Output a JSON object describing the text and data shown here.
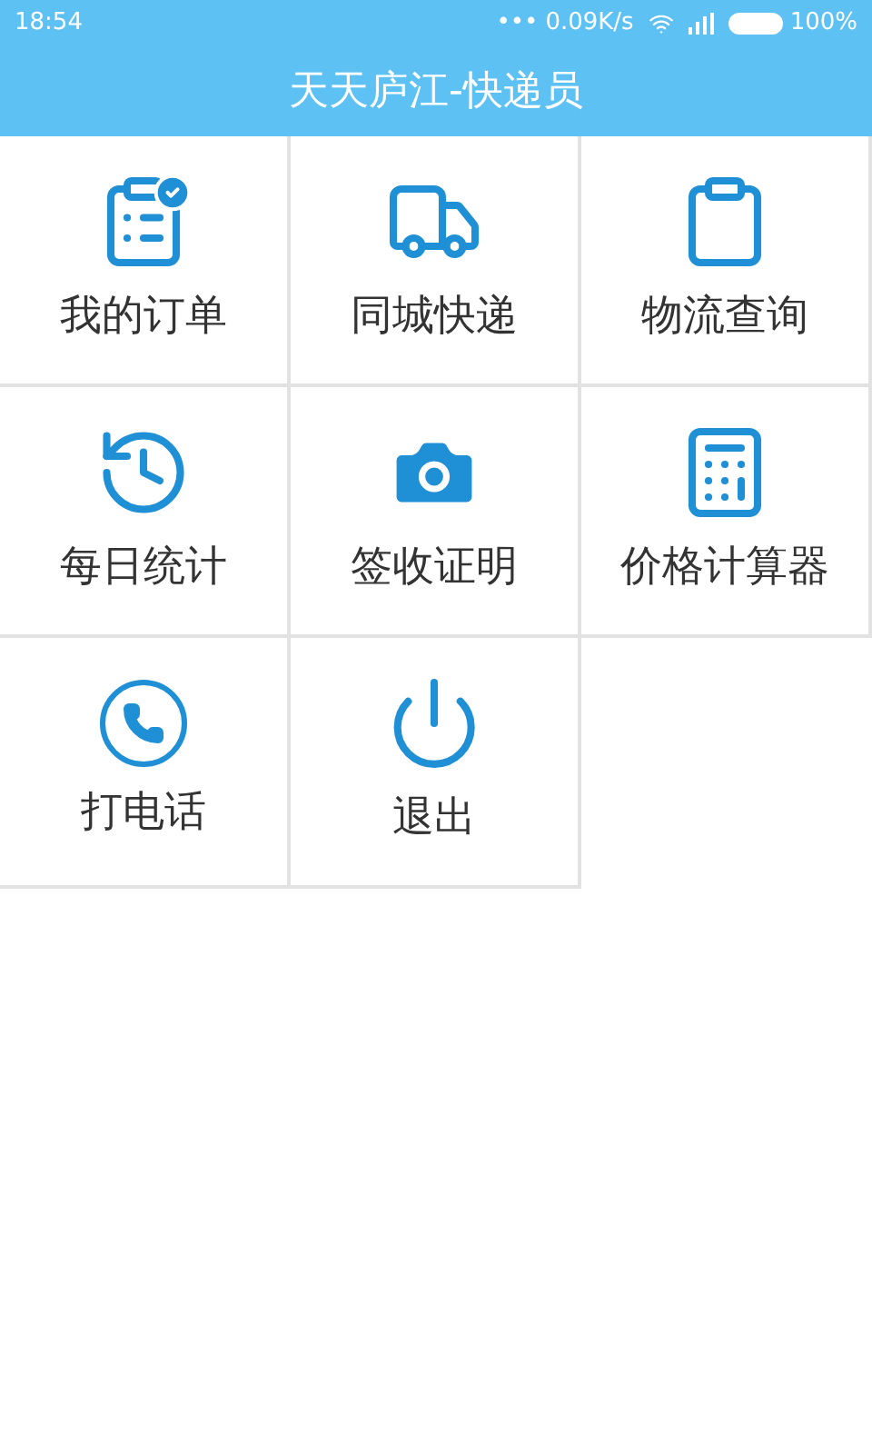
{
  "status_bar": {
    "time": "18:54",
    "dots": "•••",
    "speed": "0.09K/s",
    "battery": "100%"
  },
  "title": "天天庐江-快递员",
  "menu": [
    {
      "label": "我的订单",
      "kind": "orders"
    },
    {
      "label": "同城快递",
      "kind": "truck"
    },
    {
      "label": "物流查询",
      "kind": "clipboard"
    },
    {
      "label": "每日统计",
      "kind": "history"
    },
    {
      "label": "签收证明",
      "kind": "camera"
    },
    {
      "label": "价格计算器",
      "kind": "calculator"
    },
    {
      "label": "打电话",
      "kind": "phone"
    },
    {
      "label": "退出",
      "kind": "power"
    }
  ]
}
